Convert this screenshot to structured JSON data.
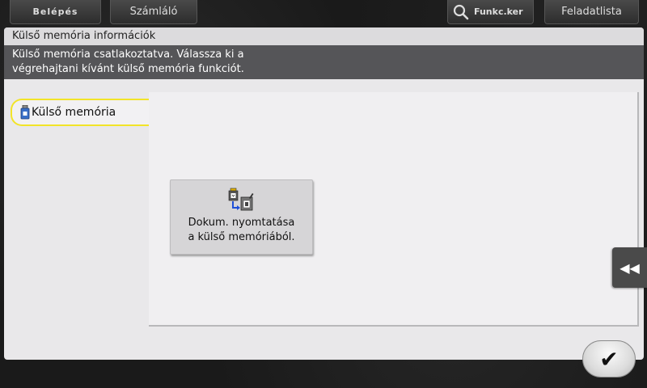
{
  "topbar": {
    "login_label": "Belépés",
    "counter_label": "Számláló",
    "search_label": "Funkc.ker",
    "search_icon": "search-icon",
    "jobs_label": "Feladatlista"
  },
  "window": {
    "title": "Külső memória információk",
    "message_line1": "Külső memória csatlakoztatva. Válassza ki a",
    "message_line2": "végrehajtani kívánt külső memória funkciót."
  },
  "tabs": [
    {
      "label": "Külső memória",
      "icon": "usb-memory-icon",
      "selected": true
    }
  ],
  "functions": [
    {
      "line1": "Dokum. nyomtatása",
      "line2": "a külső memóriából.",
      "icon": "print-from-memory-icon"
    }
  ],
  "controls": {
    "side_arrow_icon": "double-chevron-left-icon",
    "ok_icon": "checkmark-icon",
    "accent_color": "#f2e428"
  }
}
